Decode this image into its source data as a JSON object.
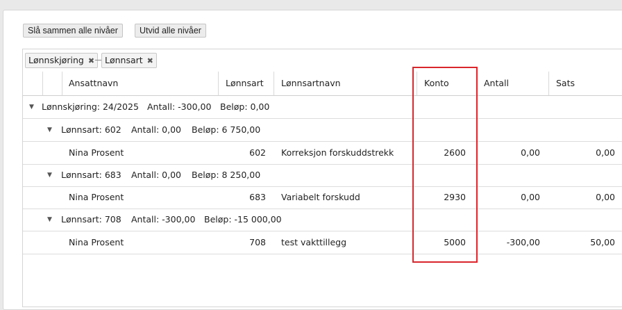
{
  "toolbar": {
    "collapse_label": "Slå sammen alle nivåer",
    "expand_label": "Utvid alle nivåer"
  },
  "group_chips": [
    {
      "label": "Lønnskjøring",
      "remove": "✖"
    },
    {
      "label": "Lønnsart",
      "remove": "✖"
    }
  ],
  "columns": {
    "ansattnavn": "Ansattnavn",
    "lonnsart": "Lønnsart",
    "lonnsartnavn": "Lønnsartnavn",
    "konto": "Konto",
    "antall": "Antall",
    "sats": "Sats"
  },
  "level1": {
    "label": "Lønnskjøring: 24/2025",
    "antall": "Antall: -300,00",
    "belop": "Beløp: 0,00"
  },
  "groups": [
    {
      "label": "Lønnsart: 602",
      "antall": "Antall: 0,00",
      "belop": "Beløp: 6 750,00",
      "row": {
        "ansattnavn": "Nina Prosent",
        "lonnsart": "602",
        "lonnsartnavn": "Korreksjon forskuddstrekk",
        "konto": "2600",
        "antall": "0,00",
        "sats": "0,00"
      }
    },
    {
      "label": "Lønnsart: 683",
      "antall": "Antall: 0,00",
      "belop": "Beløp: 8 250,00",
      "row": {
        "ansattnavn": "Nina Prosent",
        "lonnsart": "683",
        "lonnsartnavn": "Variabelt forskudd",
        "konto": "2930",
        "antall": "0,00",
        "sats": "0,00"
      }
    },
    {
      "label": "Lønnsart: 708",
      "antall": "Antall: -300,00",
      "belop": "Beløp: -15 000,00",
      "row": {
        "ansattnavn": "Nina Prosent",
        "lonnsart": "708",
        "lonnsartnavn": "test vakttillegg",
        "konto": "5000",
        "antall": "-300,00",
        "sats": "50,00"
      }
    }
  ]
}
